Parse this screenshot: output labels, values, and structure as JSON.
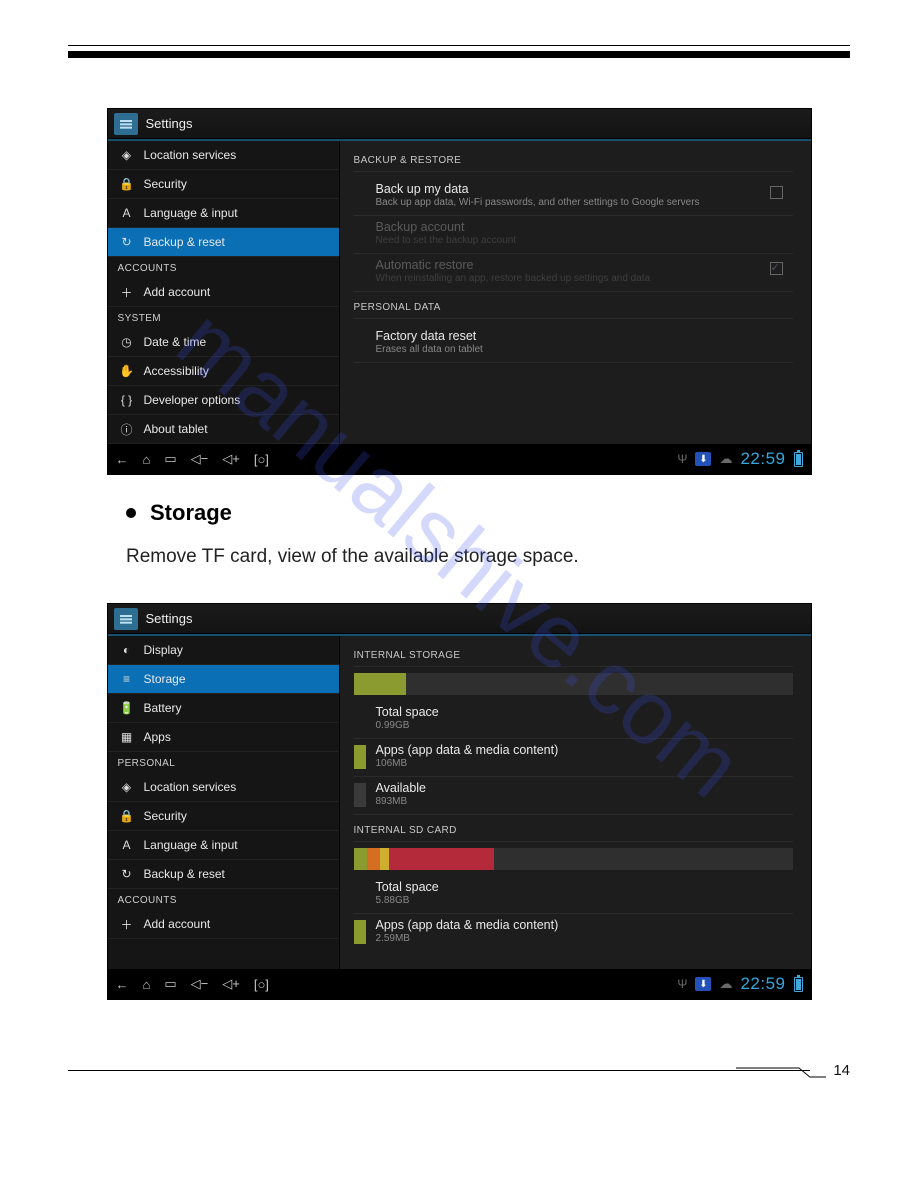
{
  "page_number": "14",
  "section_heading": "Storage",
  "body_paragraph": "Remove TF card, view of the available storage space.",
  "watermark_text": "manualshive.com",
  "shot1": {
    "title": "Settings",
    "sidebar": [
      {
        "icon": "◈",
        "label": "Location services",
        "selected": false
      },
      {
        "icon": "🔒",
        "label": "Security",
        "selected": false
      },
      {
        "icon": "A",
        "label": "Language & input",
        "selected": false
      },
      {
        "icon": "↻",
        "label": "Backup & reset",
        "selected": true
      }
    ],
    "cat_accounts": "ACCOUNTS",
    "sidebar_accounts": [
      {
        "icon": "＋",
        "label": "Add account"
      }
    ],
    "cat_system": "SYSTEM",
    "sidebar_system": [
      {
        "icon": "◷",
        "label": "Date & time"
      },
      {
        "icon": "✋",
        "label": "Accessibility"
      },
      {
        "icon": "{ }",
        "label": "Developer options"
      },
      {
        "icon": "ⓘ",
        "label": "About tablet"
      }
    ],
    "main": {
      "sect1": "BACKUP & RESTORE",
      "rows1": [
        {
          "title": "Back up my data",
          "sub": "Back up app data, Wi-Fi passwords, and other settings to Google servers",
          "disabled": false,
          "checkbox": true
        },
        {
          "title": "Backup account",
          "sub": "Need to set the backup account",
          "disabled": true
        },
        {
          "title": "Automatic restore",
          "sub": "When reinstalling an app, restore backed up settings and data",
          "disabled": true,
          "checkbox_on": true
        }
      ],
      "sect2": "PERSONAL DATA",
      "rows2": [
        {
          "title": "Factory data reset",
          "sub": "Erases all data on tablet"
        }
      ]
    },
    "clock": "22:59"
  },
  "shot2": {
    "title": "Settings",
    "sidebar": [
      {
        "icon": "◐",
        "label": "Display"
      },
      {
        "icon": "≡",
        "label": "Storage",
        "selected": true
      },
      {
        "icon": "🔋",
        "label": "Battery"
      },
      {
        "icon": "▦",
        "label": "Apps"
      }
    ],
    "cat_personal": "PERSONAL",
    "sidebar_personal": [
      {
        "icon": "◈",
        "label": "Location services"
      },
      {
        "icon": "🔒",
        "label": "Security"
      },
      {
        "icon": "A",
        "label": "Language & input"
      },
      {
        "icon": "↻",
        "label": "Backup & reset"
      }
    ],
    "cat_accounts": "ACCOUNTS",
    "sidebar_accounts": [
      {
        "icon": "＋",
        "label": "Add account"
      }
    ],
    "main": {
      "sect1": "INTERNAL STORAGE",
      "bar1": [
        {
          "color": "#8c9b2f",
          "w": 12
        }
      ],
      "rows1": [
        {
          "title": "Total space",
          "sub": "0.99GB"
        },
        {
          "title": "Apps (app data & media content)",
          "sub": "106MB",
          "swatch": "sw-green"
        },
        {
          "title": "Available",
          "sub": "893MB",
          "swatch": "sw-grey"
        }
      ],
      "sect2": "INTERNAL SD CARD",
      "bar2": [
        {
          "color": "#8c9b2f",
          "w": 3
        },
        {
          "color": "#d56e20",
          "w": 3
        },
        {
          "color": "#cdae2e",
          "w": 2
        },
        {
          "color": "#b42a3a",
          "w": 24
        }
      ],
      "rows2": [
        {
          "title": "Total space",
          "sub": "5.88GB"
        },
        {
          "title": "Apps (app data & media content)",
          "sub": "2.59MB",
          "swatch": "sw-green"
        }
      ]
    },
    "clock": "22:59"
  },
  "nav_icons": {
    "back": "←",
    "home": "⌂",
    "recent": "▭",
    "vol_down": "◁−",
    "vol_up": "◁+",
    "expand": "[○]"
  }
}
